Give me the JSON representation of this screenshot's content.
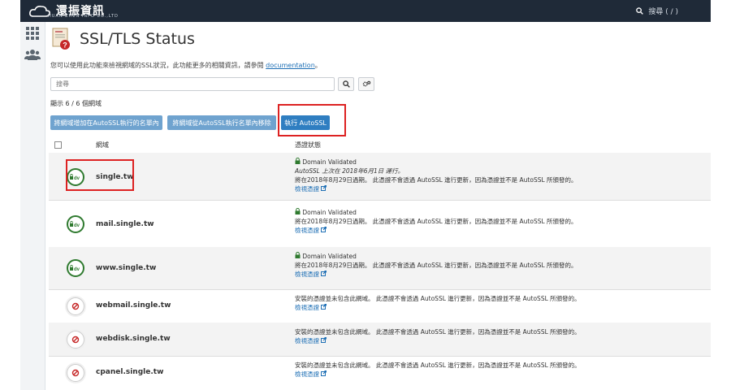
{
  "brand": {
    "name": "還振資訊",
    "sub": "HUAN ZHEN INFO CO.,LTD"
  },
  "topbar": {
    "search_placeholder": "搜尋 ( / )"
  },
  "page": {
    "title": "SSL/TLS Status",
    "description_prefix": "您可以使用此功能來檢視網域的SSL狀況，此功能更多的相關資訊，請參閱",
    "description_link": "documentation",
    "description_suffix": "。"
  },
  "search": {
    "placeholder": "搜尋"
  },
  "showing": "顯示 6 / 6 個網域",
  "buttons": {
    "include": "將網域增加在AutoSSL執行的名單內",
    "exclude": "將網域從AutoSSL執行名單內移除",
    "run": "執行 AutoSSL"
  },
  "table": {
    "col_domain": "網域",
    "col_status": "憑證狀態",
    "rows": [
      {
        "domain": "single.tw",
        "badge": "dv",
        "validated": "Domain Validated",
        "note": "AutoSSL 上次在 2018年6月1日 運行。",
        "expiry": "將在2018年8月29日過期。 此憑證不會透過 AutoSSL 進行更新，因為憑證並不是 AutoSSL 所頒發的。",
        "link": "檢視憑證"
      },
      {
        "domain": "mail.single.tw",
        "badge": "dv",
        "validated": "Domain Validated",
        "note": "",
        "expiry": "將在2018年8月29日過期。 此憑證不會透過 AutoSSL 進行更新，因為憑證並不是 AutoSSL 所頒發的。",
        "link": "檢視憑證"
      },
      {
        "domain": "www.single.tw",
        "badge": "dv",
        "validated": "Domain Validated",
        "note": "",
        "expiry": "將在2018年8月29日過期。 此憑證不會透過 AutoSSL 進行更新，因為憑證並不是 AutoSSL 所頒發的。",
        "link": "檢視憑證"
      },
      {
        "domain": "webmail.single.tw",
        "badge": "none",
        "validated": "",
        "note": "",
        "expiry": "安裝的憑證並未包含此網域。 此憑證不會透過 AutoSSL 進行更新，因為憑證並不是 AutoSSL 所頒發的。",
        "link": "檢視憑證"
      },
      {
        "domain": "webdisk.single.tw",
        "badge": "none",
        "validated": "",
        "note": "",
        "expiry": "安裝的憑證並未包含此網域。 此憑證不會透過 AutoSSL 進行更新，因為憑證並不是 AutoSSL 所頒發的。",
        "link": "檢視憑證"
      },
      {
        "domain": "cpanel.single.tw",
        "badge": "none",
        "validated": "",
        "note": "",
        "expiry": "安裝的憑證並未包含此網域。 此憑證不會透過 AutoSSL 進行更新，因為憑證並不是 AutoSSL 所頒發的。",
        "link": "檢視憑證"
      }
    ]
  },
  "colors": {
    "topbar": "#1f2a38",
    "button": "#6fa3cf",
    "button_primary": "#2f7ec1",
    "highlight": "#dd2222",
    "dv_green": "#2f7a2f"
  }
}
